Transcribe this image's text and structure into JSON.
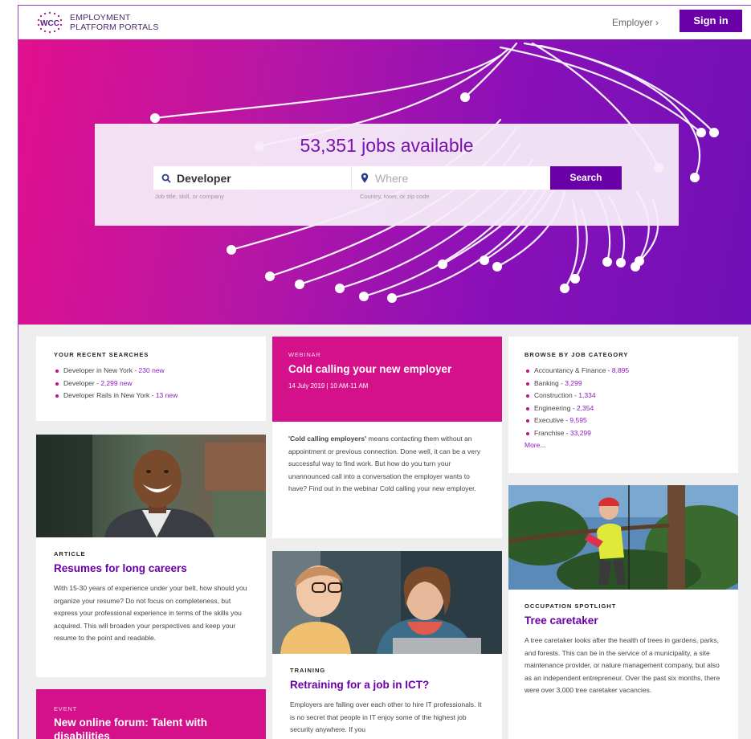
{
  "header": {
    "logo_badge": "WCC",
    "logo_line1": "EMPLOYMENT",
    "logo_line2": "PLATFORM PORTALS",
    "employer_link": "Employer ›",
    "sign_in": "Sign in"
  },
  "hero": {
    "jobs_count": "53,351 jobs available",
    "what_value": "Developer",
    "what_hint": "Job title, skill, or company",
    "where_placeholder": "Where",
    "where_hint": "Country, town, or zip code",
    "search_label": "Search"
  },
  "recent_searches": {
    "heading": "YOUR RECENT SEARCHES",
    "items": [
      {
        "text": "Developer in New York - ",
        "count": "230 new"
      },
      {
        "text": "Developer - ",
        "count": "2,299 new"
      },
      {
        "text": "Developer Rails in New York - ",
        "count": "13 new"
      }
    ]
  },
  "webinar": {
    "eyebrow": "WEBINAR",
    "title": "Cold calling your new employer",
    "meta": "14 July 2019  |  10 AM-11 AM",
    "body_bold": "'Cold calling employers'",
    "body": " means contacting them without an appointment or previous connection. Done well, it can be a very successful way to find work. But how do you turn your unannounced call into a conversation the employer wants to have? Find out in the webinar Cold calling your new employer."
  },
  "categories": {
    "heading": "BROWSE BY JOB CATEGORY",
    "items": [
      {
        "text": "Accountancy & Finance - ",
        "count": "8,895"
      },
      {
        "text": "Banking - ",
        "count": "3,299"
      },
      {
        "text": "Construction - ",
        "count": "1,334"
      },
      {
        "text": "Engineering - ",
        "count": "2,354"
      },
      {
        "text": "Executive - ",
        "count": "9,595"
      },
      {
        "text": "Franchise - ",
        "count": "33,299"
      }
    ],
    "more": "More..."
  },
  "article": {
    "eyebrow": "ARTICLE",
    "title": "Resumes for long careers",
    "body": "With 15-30 years of experience under your belt, how should you organize your resume? Do not focus on completeness, but express your professional experience in terms of the skills you acquired. This will broaden your perspectives and keep your resume to the point and readable."
  },
  "training": {
    "eyebrow": "TRAINING",
    "title": "Retraining for a job in ICT?",
    "body": "Employers are falling over each other to hire IT professionals. It is no secret that people in IT enjoy some of the highest job security anywhere. If you"
  },
  "spotlight": {
    "eyebrow": "OCCUPATION SPOTLIGHT",
    "title": "Tree caretaker",
    "body": "A tree caretaker looks after the health of trees in gardens, parks, and forests. This can be in the service of a municipality, a site maintenance provider, or nature management company, but also as an independent entrepreneur. Over the past six months, there were over 3,000 tree caretaker vacancies."
  },
  "event": {
    "eyebrow": "EVENT",
    "title": "New online forum: Talent with disabilities"
  },
  "colors": {
    "brand_purple": "#6a00a8",
    "brand_pink": "#d4108a",
    "hero_start": "#e2108e",
    "hero_end": "#6f10b6"
  }
}
